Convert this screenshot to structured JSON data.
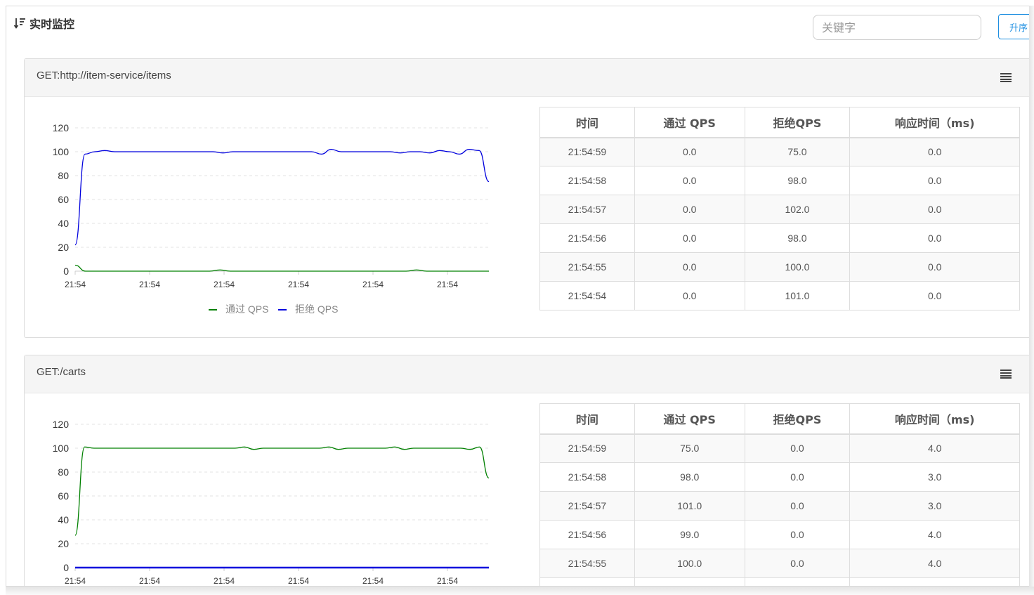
{
  "header": {
    "title": "实时监控",
    "search_placeholder": "关键字",
    "sort_button": "升序"
  },
  "colors": {
    "pass": "#008000",
    "block": "#0000dd",
    "accent": "#1e8fe1"
  },
  "icons": {
    "sort": "sort-icon",
    "menu": "menu-icon"
  },
  "table_headers": [
    "时间",
    "通过 QPS",
    "拒绝QPS",
    "响应时间（ms)"
  ],
  "legend": {
    "pass": "通过 QPS",
    "block": "拒绝 QPS"
  },
  "panels": [
    {
      "title": "GET:http://item-service/items",
      "rows": [
        [
          "21:54:59",
          "0.0",
          "75.0",
          "0.0"
        ],
        [
          "21:54:58",
          "0.0",
          "98.0",
          "0.0"
        ],
        [
          "21:54:57",
          "0.0",
          "102.0",
          "0.0"
        ],
        [
          "21:54:56",
          "0.0",
          "98.0",
          "0.0"
        ],
        [
          "21:54:55",
          "0.0",
          "100.0",
          "0.0"
        ],
        [
          "21:54:54",
          "0.0",
          "101.0",
          "0.0"
        ]
      ]
    },
    {
      "title": "GET:/carts",
      "rows": [
        [
          "21:54:59",
          "75.0",
          "0.0",
          "4.0"
        ],
        [
          "21:54:58",
          "98.0",
          "0.0",
          "3.0"
        ],
        [
          "21:54:57",
          "101.0",
          "0.0",
          "3.0"
        ],
        [
          "21:54:56",
          "99.0",
          "0.0",
          "4.0"
        ],
        [
          "21:54:55",
          "100.0",
          "0.0",
          "4.0"
        ],
        [
          "",
          "",
          "",
          ""
        ]
      ]
    }
  ],
  "chart_data": [
    {
      "type": "line",
      "xlabel": "",
      "ylabel": "",
      "ylim": [
        0,
        120
      ],
      "yticks": [
        0,
        20,
        40,
        60,
        80,
        100,
        120
      ],
      "xticks": [
        "21:54",
        "21:54",
        "21:54",
        "21:54",
        "21:54",
        "21:54"
      ],
      "grid": true,
      "legend": "bottom",
      "series": [
        {
          "name": "通过 QPS",
          "color": "#008000",
          "values": [
            5,
            0,
            0,
            0,
            0,
            0,
            0,
            0,
            0,
            0,
            0,
            0,
            0,
            0,
            1,
            0,
            0,
            0,
            0,
            0,
            0,
            0,
            0,
            0,
            0,
            0,
            0,
            0,
            0,
            0,
            0,
            0,
            0,
            1,
            0,
            0,
            0,
            0,
            0,
            0,
            0
          ]
        },
        {
          "name": "拒绝 QPS",
          "color": "#0000dd",
          "values": [
            22,
            98,
            100,
            101,
            100,
            100,
            100,
            100,
            100,
            100,
            100,
            100,
            100,
            100,
            100,
            99,
            100,
            100,
            100,
            100,
            100,
            100,
            100,
            100,
            100,
            98,
            102,
            100,
            100,
            100,
            100,
            100,
            100,
            99,
            100,
            100,
            99,
            101,
            100,
            98,
            102,
            101,
            75
          ]
        }
      ]
    },
    {
      "type": "line",
      "xlabel": "",
      "ylabel": "",
      "ylim": [
        0,
        120
      ],
      "yticks": [
        0,
        20,
        40,
        60,
        80,
        100,
        120
      ],
      "xticks": [
        "21:54",
        "21:54",
        "21:54",
        "21:54",
        "21:54",
        "21:54"
      ],
      "grid": true,
      "series": [
        {
          "name": "通过 QPS",
          "color": "#008000",
          "values": [
            27,
            101,
            100,
            100,
            100,
            100,
            100,
            100,
            100,
            100,
            100,
            100,
            100,
            100,
            100,
            100,
            100,
            100,
            101,
            99,
            100,
            100,
            100,
            100,
            100,
            100,
            100,
            101,
            99,
            100,
            100,
            100,
            100,
            100,
            101,
            99,
            100,
            100,
            100,
            100,
            100,
            100,
            99,
            101,
            75
          ]
        },
        {
          "name": "拒绝 QPS",
          "color": "#0000dd",
          "values": [
            0,
            0,
            0,
            0,
            0,
            0,
            0,
            0,
            0,
            0,
            0,
            0,
            0,
            0,
            0,
            0,
            0,
            0,
            0,
            0,
            0,
            0,
            0,
            0,
            0,
            0,
            0,
            0,
            0,
            0,
            0,
            0,
            0,
            0,
            0,
            0,
            0,
            0,
            0,
            0,
            0,
            0,
            0,
            0,
            0
          ]
        }
      ]
    }
  ]
}
